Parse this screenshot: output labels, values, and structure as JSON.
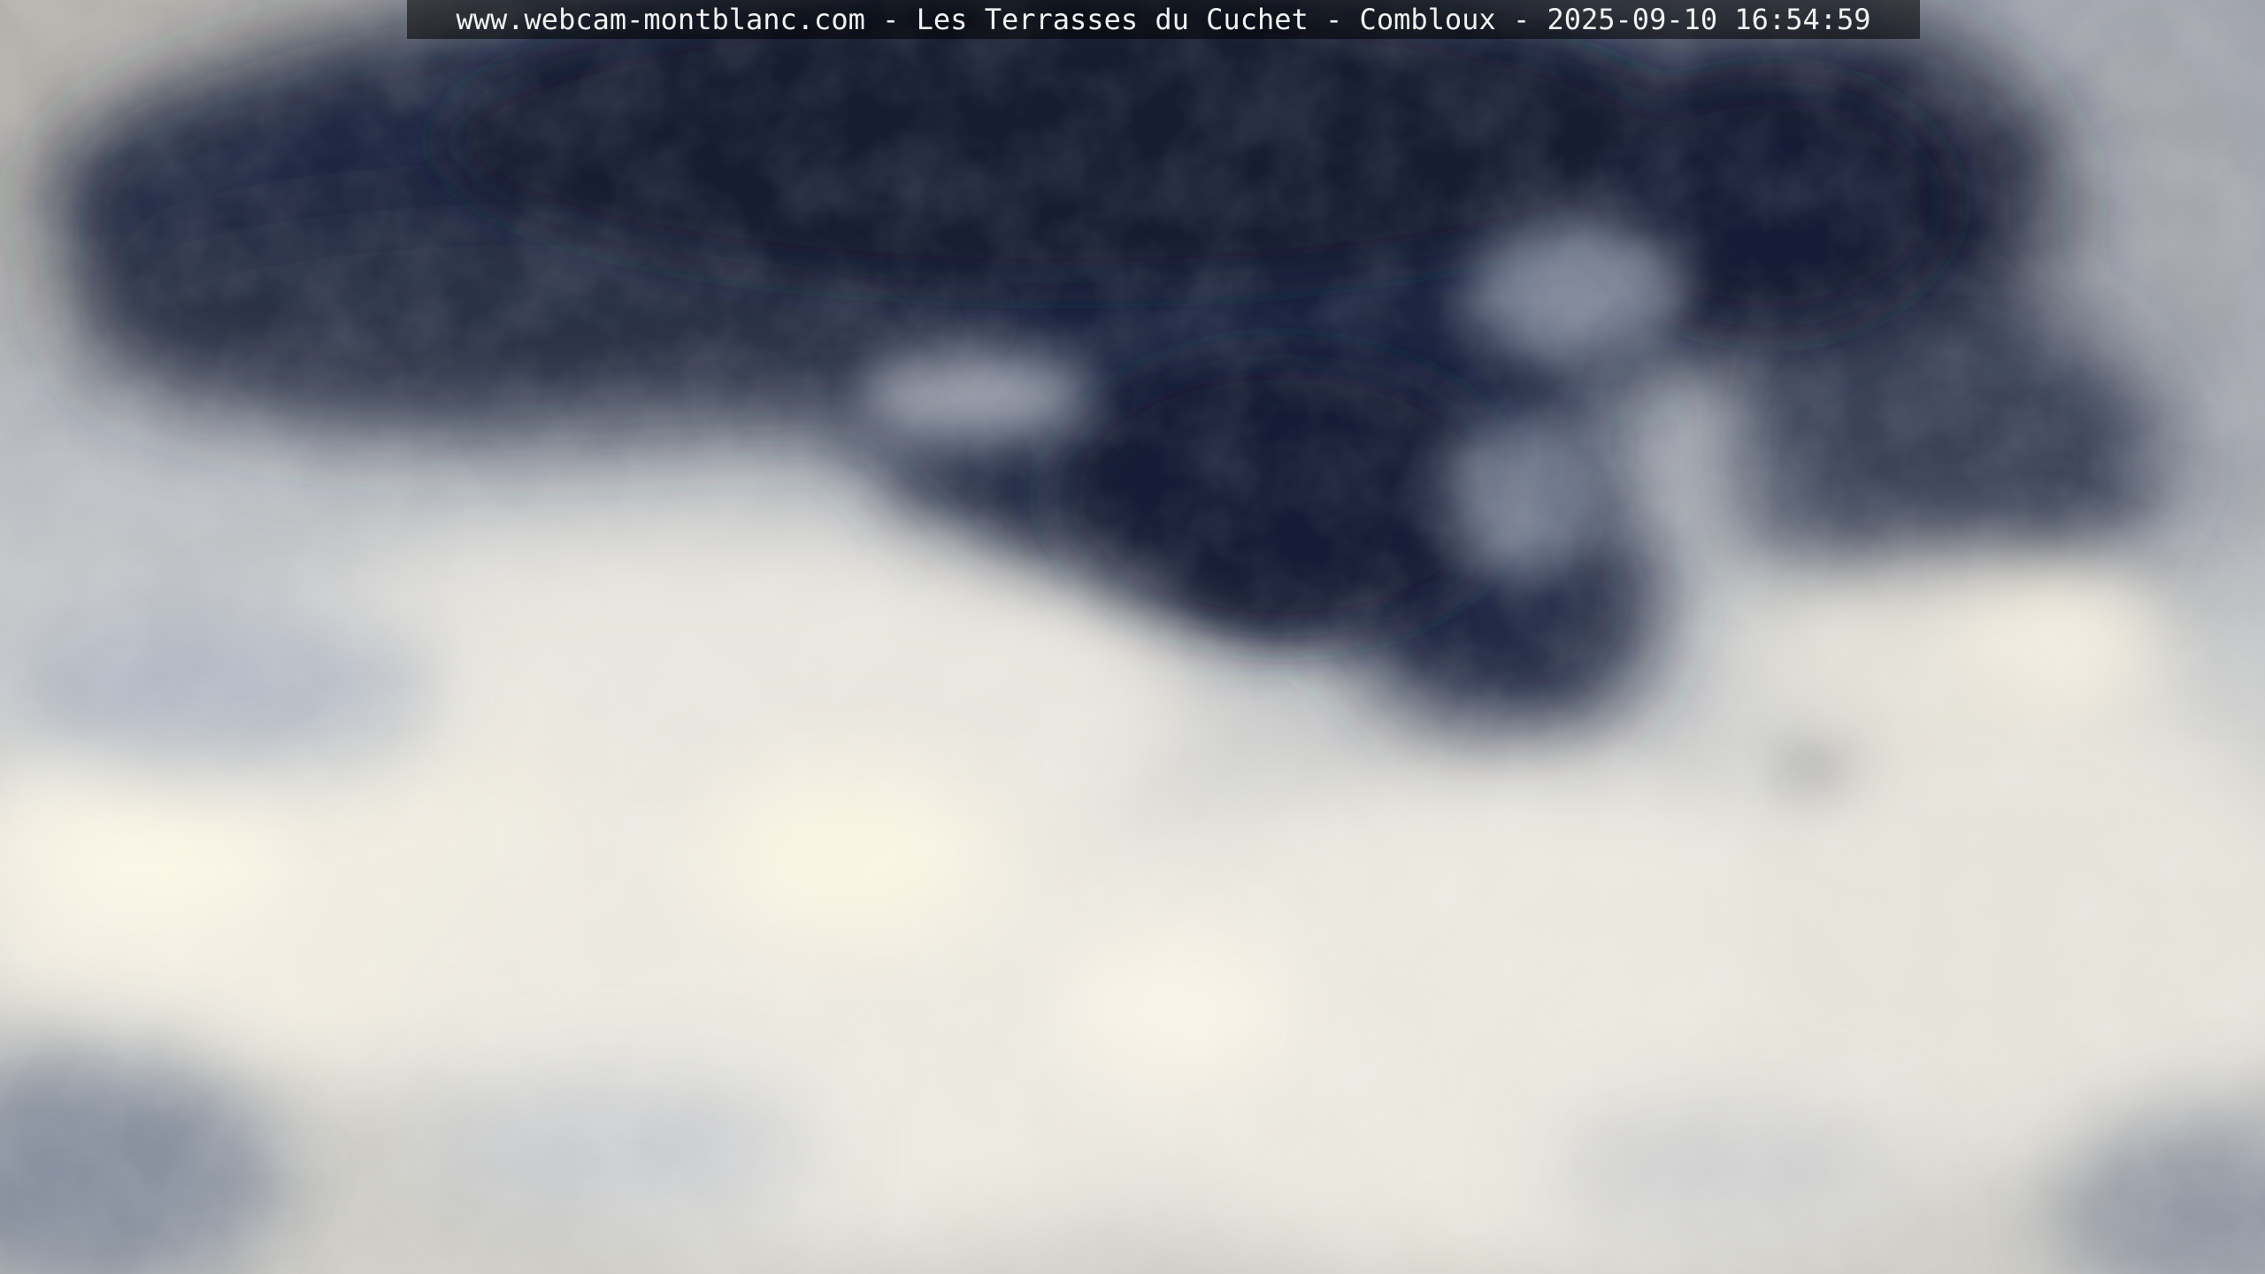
{
  "webcam": {
    "caption": "www.webcam-montblanc.com - Les Terrasses du Cuchet - Combloux - 2025-09-10 16:54:59"
  },
  "scene": {
    "subject": "cloudy sky",
    "colors": {
      "storm_cloud": "#1b2540",
      "bright_cloud": "#f1ede2",
      "mid_cloud": "#9aa3b3",
      "caption_bg": "#000000",
      "caption_text": "#f2f2f2"
    }
  }
}
